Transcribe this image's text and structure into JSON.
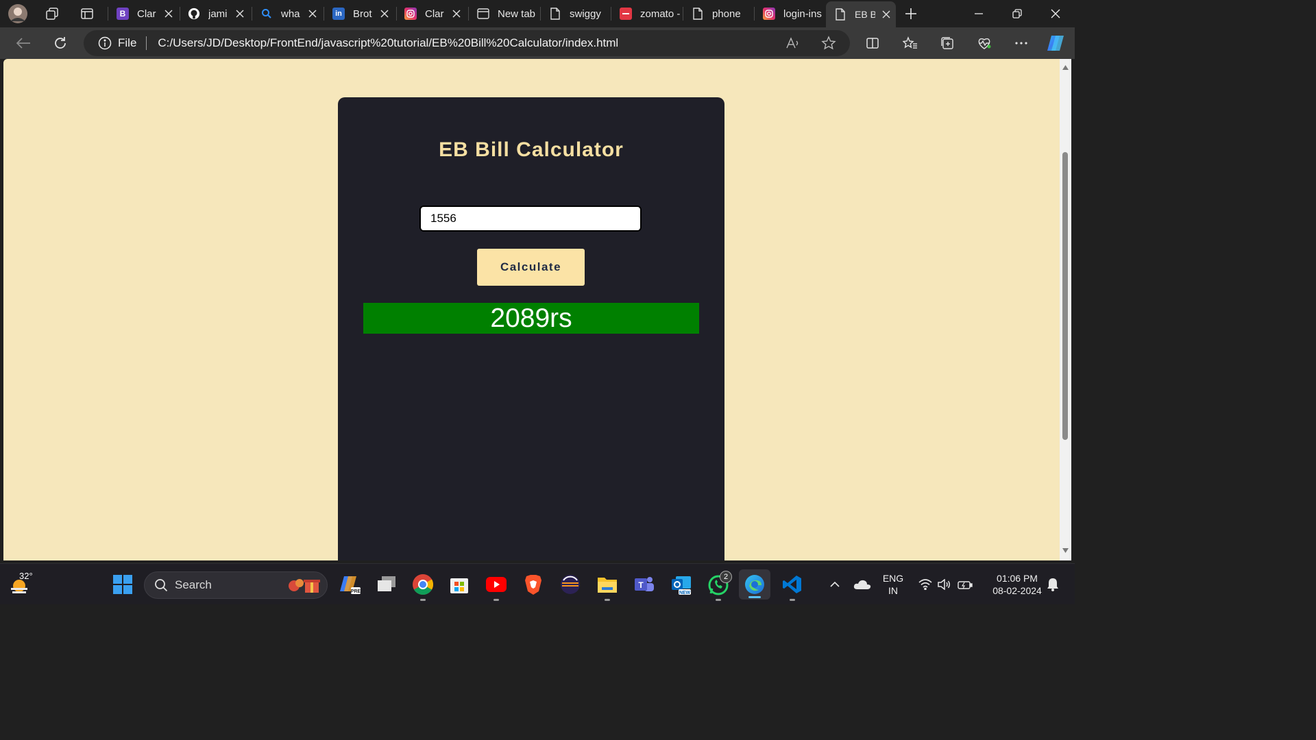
{
  "browser": {
    "tabs": [
      {
        "title": "Clar",
        "favicon": "bootstrap-icon",
        "closable": true
      },
      {
        "title": "jami",
        "favicon": "github-icon",
        "closable": true
      },
      {
        "title": "wha",
        "favicon": "search-icon",
        "closable": true
      },
      {
        "title": "Brot",
        "favicon": "linkedin-icon",
        "closable": true
      },
      {
        "title": "Clar",
        "favicon": "instagram-icon",
        "closable": true
      },
      {
        "title": "New tab",
        "favicon": "newtab-icon",
        "closable": false
      },
      {
        "title": "swiggy",
        "favicon": "file-icon",
        "closable": false
      },
      {
        "title": "zomato -",
        "favicon": "zomato-icon",
        "closable": false
      },
      {
        "title": "phone",
        "favicon": "file-icon",
        "closable": false
      },
      {
        "title": "login-ins",
        "favicon": "instagram-icon",
        "closable": false
      },
      {
        "title": "EB B",
        "favicon": "file-icon",
        "closable": true,
        "active": true
      }
    ],
    "scheme_label": "File",
    "url": "C:/Users/JD/Desktop/FrontEnd/javascript%20tutorial/EB%20Bill%20Calculator/index.html"
  },
  "page": {
    "title": "EB Bill Calculator",
    "units_input_value": "1556",
    "calculate_label": "Calculate",
    "result_text": "2089rs",
    "colors": {
      "background": "#f6e7bb",
      "card": "#1f1f28",
      "title": "#f5dfa2",
      "button": "#fbe3a6",
      "result": "#008000"
    }
  },
  "taskbar": {
    "weather_temp": "32°",
    "search_label": "Search",
    "language": "ENG",
    "region": "IN",
    "time": "01:06 PM",
    "date": "08-02-2024",
    "whatsapp_badge": "2"
  }
}
